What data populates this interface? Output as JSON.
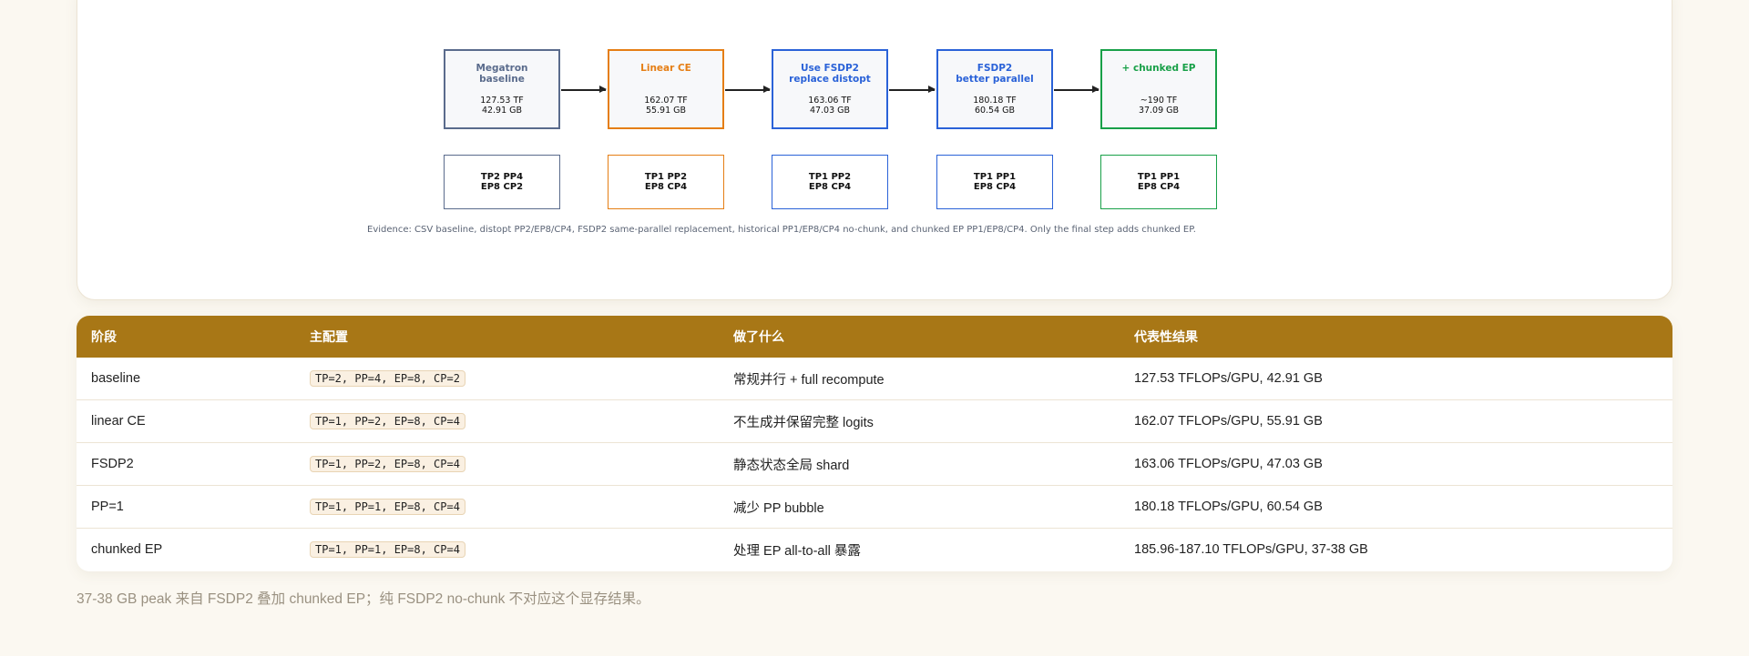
{
  "pipeline": {
    "stages": [
      {
        "title": "Megatron\nbaseline",
        "tflops": "127.53 TF",
        "memory": "42.91 GB",
        "config": [
          "TP2 PP4",
          "EP8 CP2"
        ],
        "color": "#5a6b8c"
      },
      {
        "title": "Linear CE",
        "tflops": "162.07 TF",
        "memory": "55.91 GB",
        "config": [
          "TP1 PP2",
          "EP8 CP4"
        ],
        "color": "#e57e14"
      },
      {
        "title": "Use FSDP2\nreplace distopt",
        "tflops": "163.06 TF",
        "memory": "47.03 GB",
        "config": [
          "TP1 PP2",
          "EP8 CP4"
        ],
        "color": "#2a62d8"
      },
      {
        "title": "FSDP2\nbetter parallel",
        "tflops": "180.18 TF",
        "memory": "60.54 GB",
        "config": [
          "TP1 PP1",
          "EP8 CP4"
        ],
        "color": "#2a62d8"
      },
      {
        "title": "+ chunked EP",
        "tflops": "~190 TF",
        "memory": "37.09 GB",
        "config": [
          "TP1 PP1",
          "EP8 CP4"
        ],
        "color": "#18a048"
      }
    ],
    "evidence": "Evidence: CSV baseline, distopt PP2/EP8/CP4, FSDP2 same-parallel replacement, historical PP1/EP8/CP4 no-chunk, and chunked EP PP1/EP8/CP4. Only the final step adds chunked EP."
  },
  "table": {
    "headers": [
      "阶段",
      "主配置",
      "做了什么",
      "代表性结果"
    ],
    "rows": [
      {
        "stage": "baseline",
        "config": "TP=2, PP=4, EP=8, CP=2",
        "action": "常规并行 + full recompute",
        "result": "127.53 TFLOPs/GPU, 42.91 GB"
      },
      {
        "stage": "linear CE",
        "config": "TP=1, PP=2, EP=8, CP=4",
        "action": "不生成并保留完整 logits",
        "result": "162.07 TFLOPs/GPU, 55.91 GB"
      },
      {
        "stage": "FSDP2",
        "config": "TP=1, PP=2, EP=8, CP=4",
        "action": "静态状态全局 shard",
        "result": "163.06 TFLOPs/GPU, 47.03 GB"
      },
      {
        "stage": "PP=1",
        "config": "TP=1, PP=1, EP=8, CP=4",
        "action": "减少 PP bubble",
        "result": "180.18 TFLOPs/GPU, 60.54 GB"
      },
      {
        "stage": "chunked EP",
        "config": "TP=1, PP=1, EP=8, CP=4",
        "action": "处理 EP all-to-all 暴露",
        "result": "185.96-187.10 TFLOPs/GPU, 37-38 GB"
      }
    ]
  },
  "footnote": "37-38 GB peak 来自 FSDP2 叠加 chunked EP；纯 FSDP2 no-chunk 不对应这个显存结果。",
  "colors": {
    "header_bg": "#a87716",
    "page_bg": "#fbf8f1"
  }
}
